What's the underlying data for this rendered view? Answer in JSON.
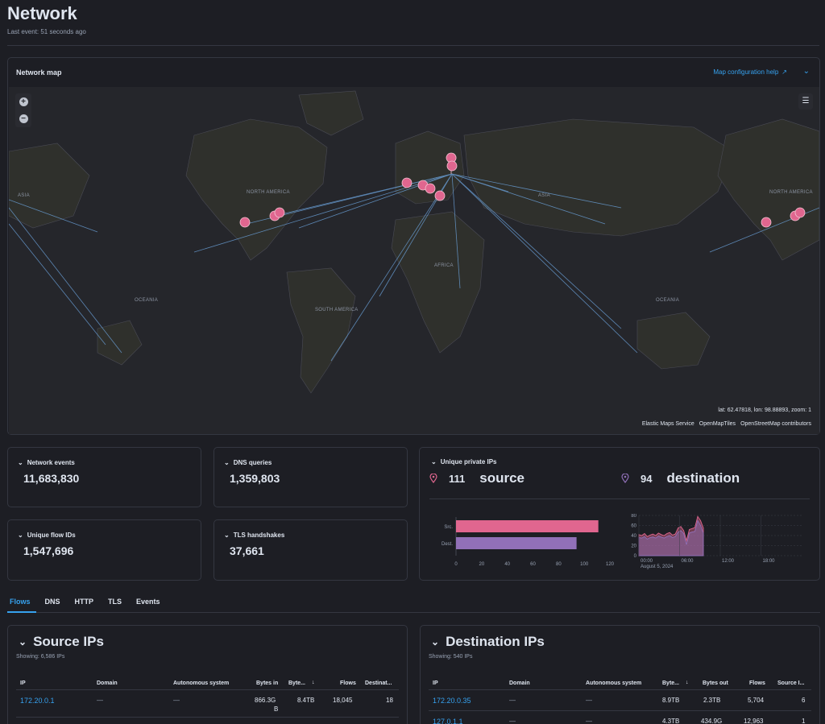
{
  "header": {
    "title": "Network",
    "subtitle": "Last event: 51 seconds ago"
  },
  "map": {
    "title": "Network map",
    "help_link": "Map configuration help",
    "coords": "lat: 62.47818, lon: 98.88893, zoom: 1",
    "attribution": [
      "Elastic Maps Service",
      "OpenMapTiles",
      "OpenStreetMap contributors"
    ],
    "continents": [
      "NORTH AMERICA",
      "ASIA",
      "OCEANIA",
      "SOUTH AMERICA",
      "AFRICA",
      "ASIA",
      "OCEANIA",
      "NORTH AMERICA"
    ],
    "colors": {
      "pin": "#e0668f",
      "line": "#6aa0d8",
      "land": "#2f302c",
      "sea": "#25262b"
    }
  },
  "stats": [
    {
      "label": "Network events",
      "value": "11,683,830"
    },
    {
      "label": "DNS queries",
      "value": "1,359,803"
    },
    {
      "label": "Unique flow IDs",
      "value": "1,547,696"
    },
    {
      "label": "TLS handshakes",
      "value": "37,661"
    }
  ],
  "unique_ips": {
    "label": "Unique private IPs",
    "source": {
      "count": "111",
      "word": "source"
    },
    "destination": {
      "count": "94",
      "word": "destination"
    }
  },
  "chart_data": [
    {
      "type": "bar",
      "orientation": "horizontal",
      "categories": [
        "Src.",
        "Dest."
      ],
      "values": [
        111,
        94
      ],
      "xlim": [
        0,
        120
      ],
      "xticks": [
        "0",
        "20",
        "40",
        "60",
        "80",
        "100",
        "120"
      ],
      "colors": [
        "#e0668f",
        "#9170b8"
      ]
    },
    {
      "type": "area",
      "x": [
        "00:00",
        "06:00",
        "12:00",
        "18:00"
      ],
      "xsub": "August 5, 2024",
      "yticks": [
        "0",
        "20",
        "40",
        "60",
        "80"
      ],
      "ylim": [
        0,
        80
      ],
      "series": [
        {
          "values": [
            42,
            40,
            44,
            38,
            41,
            43,
            40,
            45,
            42,
            40,
            44,
            46,
            41,
            43,
            55,
            58,
            50,
            30,
            52,
            54,
            56,
            78,
            70,
            55
          ]
        },
        {
          "values": [
            36,
            35,
            38,
            33,
            36,
            37,
            35,
            39,
            37,
            35,
            38,
            40,
            36,
            38,
            47,
            50,
            44,
            22,
            45,
            47,
            48,
            70,
            60,
            45
          ]
        }
      ],
      "colors": [
        "#e0668f",
        "#9170b8"
      ]
    }
  ],
  "tabs": [
    "Flows",
    "DNS",
    "HTTP",
    "TLS",
    "Events"
  ],
  "source_table": {
    "title": "Source IPs",
    "showing": "Showing: 6,586 IPs",
    "columns": [
      "IP",
      "Domain",
      "Autonomous system",
      "Bytes in",
      "Byte...",
      "Flows",
      "Destinat..."
    ],
    "rows": [
      {
        "ip": "172.20.0.1",
        "domain": "—",
        "as": "—",
        "bytes_in": "866.3G",
        "bytes_in2": "B",
        "bytes_out": "8.4TB",
        "flows": "18,045",
        "count": "18"
      }
    ]
  },
  "dest_table": {
    "title": "Destination IPs",
    "showing": "Showing: 540 IPs",
    "columns": [
      "IP",
      "Domain",
      "Autonomous system",
      "Byte...",
      "Bytes out",
      "Flows",
      "Source I..."
    ],
    "rows": [
      {
        "ip": "172.20.0.35",
        "domain": "—",
        "as": "—",
        "bytes_in": "8.9TB",
        "bytes_out": "2.3TB",
        "flows": "5,704",
        "count": "6"
      },
      {
        "ip": "127.0.1.1",
        "domain": "—",
        "as": "—",
        "bytes_in": "4.3TB",
        "bytes_out": "434.9G",
        "flows": "12,963",
        "count": "1"
      }
    ]
  }
}
